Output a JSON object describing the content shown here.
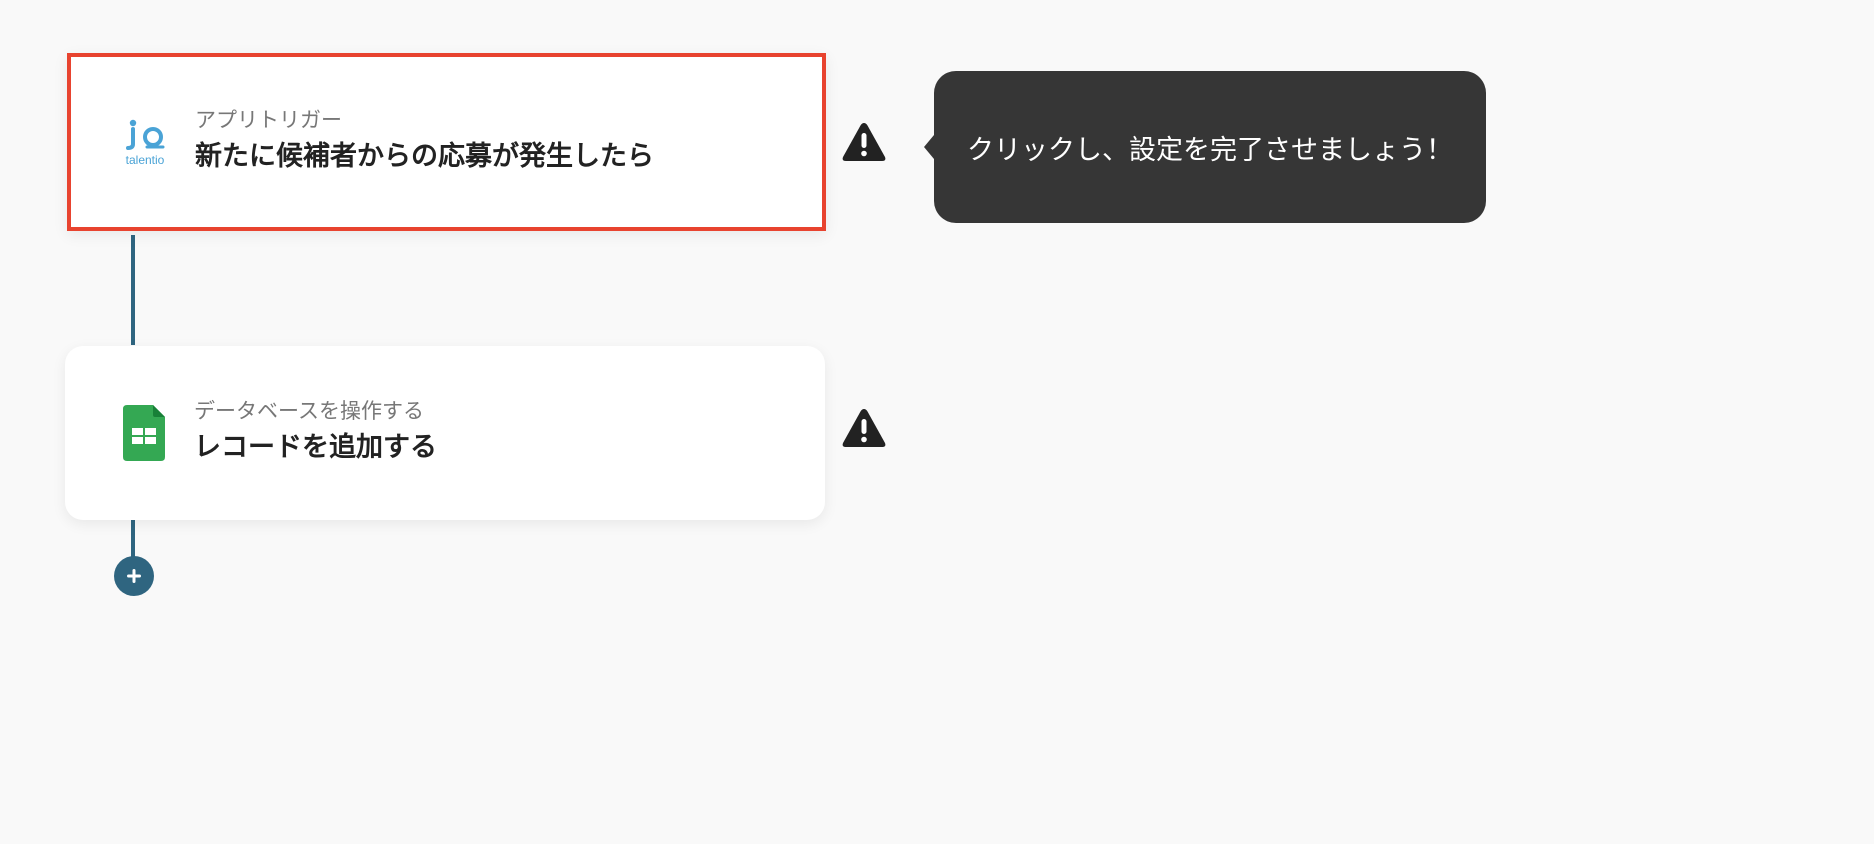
{
  "flow": {
    "steps": [
      {
        "subtitle": "アプリトリガー",
        "title": "新たに候補者からの応募が発生したら",
        "icon": "talentio-logo-icon",
        "icon_label": "talentio",
        "selected": true
      },
      {
        "subtitle": "データベースを操作する",
        "title": "レコードを追加する",
        "icon": "google-sheets-icon",
        "selected": false
      }
    ],
    "add_step_icon": "plus-icon"
  },
  "tooltip": {
    "text": "クリックし、設定を完了させましょう！"
  },
  "colors": {
    "background": "#f9f9f9",
    "selected_border": "#e8432f",
    "connector": "#2f6580",
    "tooltip_bg": "#363636",
    "warning": "#222222",
    "talentio_blue": "#4aa3d6",
    "sheets_green": "#34a853"
  }
}
